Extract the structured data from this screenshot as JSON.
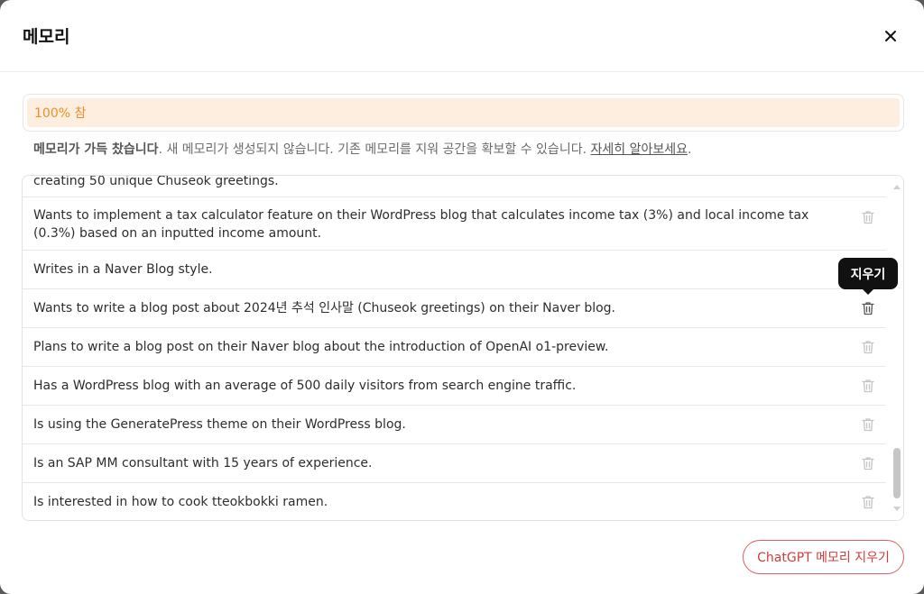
{
  "modal": {
    "title": "메모리"
  },
  "usage": {
    "text": "100% 참"
  },
  "notice": {
    "bold": "메모리가 가득 찼습니다",
    "text": ". 새 메모리가 생성되지 않습니다. 기존 메모리를 지워 공간을 확보할 수 있습니다. ",
    "link": "자세히 알아보세요",
    "end": "."
  },
  "memories": [
    {
      "text": "creating 50 unique Chuseok greetings."
    },
    {
      "text": "Wants to implement a tax calculator feature on their WordPress blog that calculates income tax (3%) and local income tax (0.3%) based on an inputted income amount."
    },
    {
      "text": "Writes in a Naver Blog style."
    },
    {
      "text": "Wants to write a blog post about 2024년 추석 인사말 (Chuseok greetings) on their Naver blog."
    },
    {
      "text": "Plans to write a blog post on their Naver blog about the introduction of OpenAI o1-preview."
    },
    {
      "text": "Has a WordPress blog with an average of 500 daily visitors from search engine traffic."
    },
    {
      "text": "Is using the GeneratePress theme on their WordPress blog."
    },
    {
      "text": "Is an SAP MM consultant with 15 years of experience."
    },
    {
      "text": "Is interested in how to cook tteokbokki ramen."
    }
  ],
  "tooltip": {
    "text": "지우기"
  },
  "footer": {
    "clear_button": "ChatGPT 메모리 지우기"
  },
  "colors": {
    "accent_red": "#d23b3b",
    "usage_orange": "#e8902b",
    "usage_bg": "#fdeee0"
  }
}
